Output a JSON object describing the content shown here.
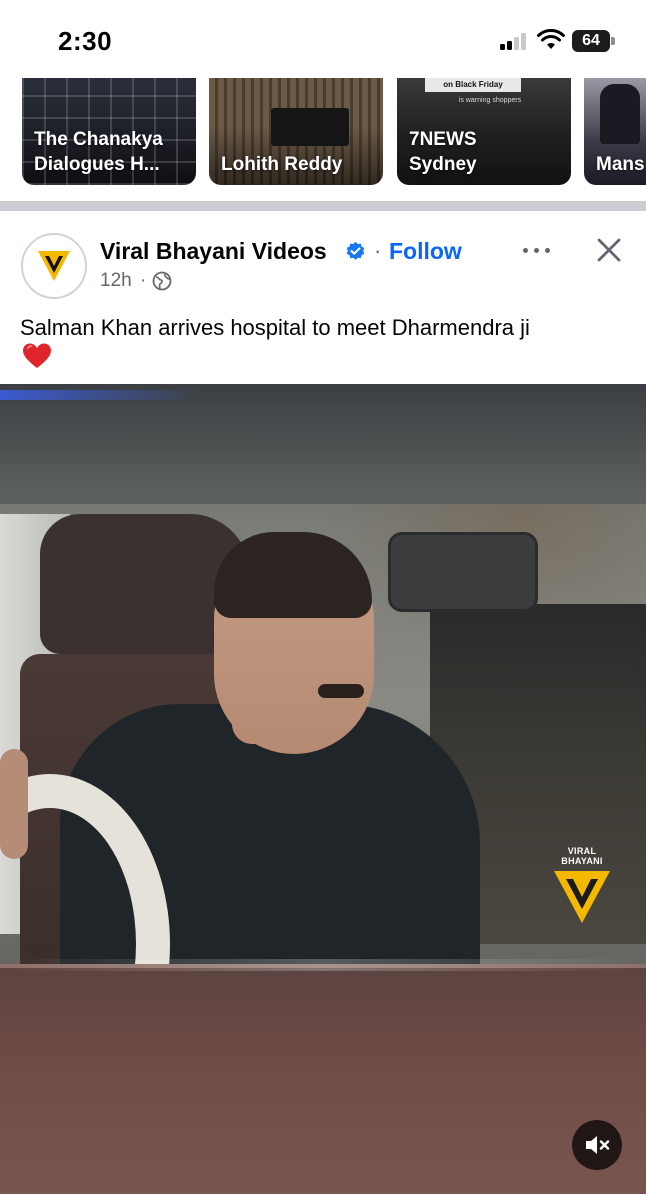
{
  "status_bar": {
    "time": "2:30",
    "battery": "64"
  },
  "stories": [
    {
      "label": "The Chanakya\nDialogues H..."
    },
    {
      "label": "Lohith Reddy"
    },
    {
      "label": "7NEWS\nSydney",
      "thumb_chip": "on Black Friday",
      "thumb_chip2": "is warning shoppers"
    },
    {
      "label": "Mans"
    }
  ],
  "post": {
    "page_name": "Viral Bhayani Videos",
    "verified": true,
    "separator_dot": "·",
    "follow_label": "Follow",
    "time_ago": "12h",
    "meta_dot": "·",
    "caption": "Salman Khan arrives hospital to meet Dharmendra ji",
    "caption_emoji": "red-heart"
  },
  "video": {
    "watermark_text": "VIRAL BHAYANI",
    "muted": true
  },
  "colors": {
    "accent": "#0866ff",
    "brand_yellow": "#f5b800",
    "text_primary": "#050505",
    "text_secondary": "#65676b"
  }
}
